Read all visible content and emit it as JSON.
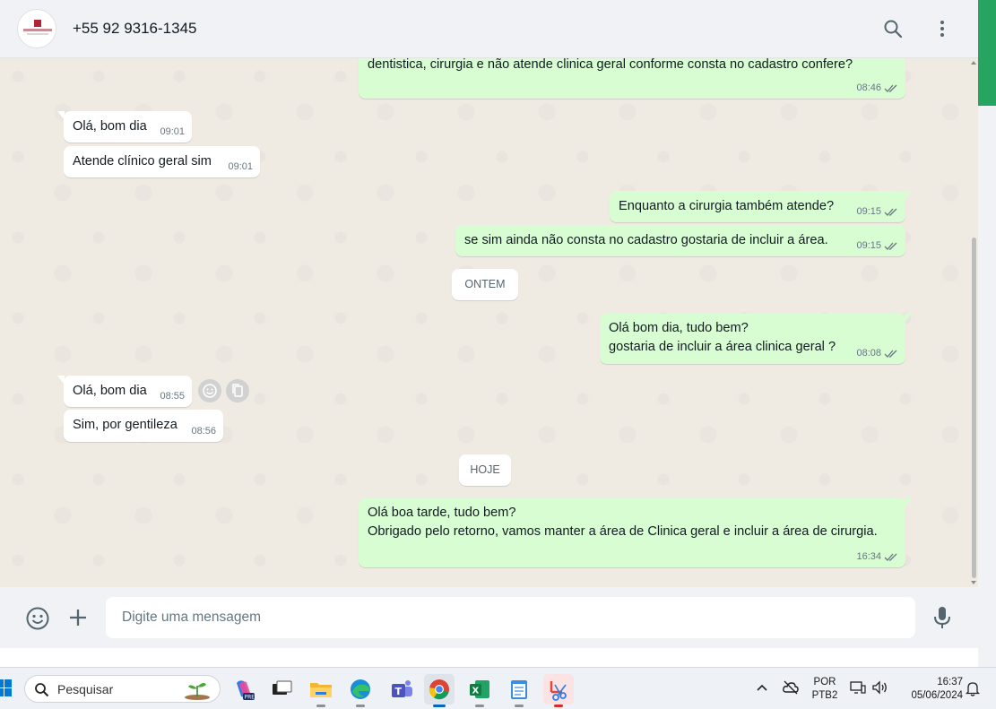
{
  "header": {
    "contact_name": "+55 92 9316-1345",
    "icons": [
      "search-icon",
      "menu-dots-icon"
    ]
  },
  "messages": [
    {
      "id": "m0",
      "direction": "out",
      "text": "dentistica, cirurgia e não atende clinica geral conforme consta no cadastro confere?",
      "time": "08:46",
      "status": "read"
    },
    {
      "id": "m1",
      "direction": "in",
      "text": "Olá, bom dia",
      "time": "09:01"
    },
    {
      "id": "m2",
      "direction": "in",
      "text": "Atende clínico geral sim",
      "time": "09:01"
    },
    {
      "id": "m3",
      "direction": "out",
      "text": "Enquanto a cirurgia também atende?",
      "time": "09:15",
      "status": "read"
    },
    {
      "id": "m4",
      "direction": "out",
      "text": "se sim ainda não consta no cadastro gostaria de incluir a área.",
      "time": "09:15",
      "status": "read"
    },
    {
      "id": "sep1",
      "type": "date",
      "label": "ONTEM"
    },
    {
      "id": "m5",
      "direction": "out",
      "text": "Olá bom dia, tudo bem?\ngostaria de incluir a área clinica geral ?",
      "time": "08:08",
      "status": "read"
    },
    {
      "id": "m6",
      "direction": "in",
      "text": "Olá, bom dia",
      "time": "08:55"
    },
    {
      "id": "m7",
      "direction": "in",
      "text": "Sim, por gentileza",
      "time": "08:56"
    },
    {
      "id": "sep2",
      "type": "date",
      "label": "HOJE"
    },
    {
      "id": "m8",
      "direction": "out",
      "text": "Olá boa tarde, tudo bem?\nObrigado pelo retorno, vamos manter a área de Clinica geral e incluir a área de cirurgia.",
      "time": "16:34",
      "status": "read"
    }
  ],
  "messages_by_id": {
    "m0": {
      "text": "dentistica, cirurgia e não atende clinica geral conforme consta no cadastro confere?",
      "time": "08:46"
    },
    "m1": {
      "text": "Olá, bom dia",
      "time": "09:01"
    },
    "m2": {
      "text": "Atende clínico geral sim",
      "time": "09:01"
    },
    "m3": {
      "text": "Enquanto a cirurgia também atende?",
      "time": "09:15"
    },
    "m4": {
      "text": "se sim ainda não consta no cadastro gostaria de incluir a área.",
      "time": "09:15"
    },
    "m5": {
      "text": "Olá bom dia, tudo bem?\ngostaria de incluir a área clinica geral ?",
      "time": "08:08"
    },
    "m6": {
      "text": "Olá, bom dia",
      "time": "08:55"
    },
    "m7": {
      "text": "Sim, por gentileza",
      "time": "08:56"
    },
    "m8": {
      "text": "Olá boa tarde, tudo bem?\nObrigado pelo retorno, vamos manter a área de Clinica geral e incluir a área de cirurgia.",
      "time": "16:34"
    }
  },
  "date_separators": {
    "ontem": "ONTEM",
    "hoje": "HOJE"
  },
  "composer": {
    "placeholder": "Digite uma mensagem",
    "icons": [
      "emoji-icon",
      "plus-icon",
      "microphone-icon"
    ]
  },
  "taskbar": {
    "search_label": "Pesquisar",
    "language_top": "POR",
    "language_bottom": "PTB2",
    "clock_time": "16:37",
    "clock_date": "05/06/2024",
    "apps": [
      "copilot-icon",
      "task-view-icon",
      "file-explorer-icon",
      "edge-icon",
      "teams-icon",
      "chrome-icon",
      "excel-icon",
      "notepad-icon",
      "snipping-tool-icon"
    ]
  },
  "colors": {
    "outgoing_bubble": "#d9fdd3",
    "incoming_bubble": "#ffffff",
    "chat_background": "#efeae2",
    "read_check": "#667781",
    "accent_green": "#25a55f"
  }
}
